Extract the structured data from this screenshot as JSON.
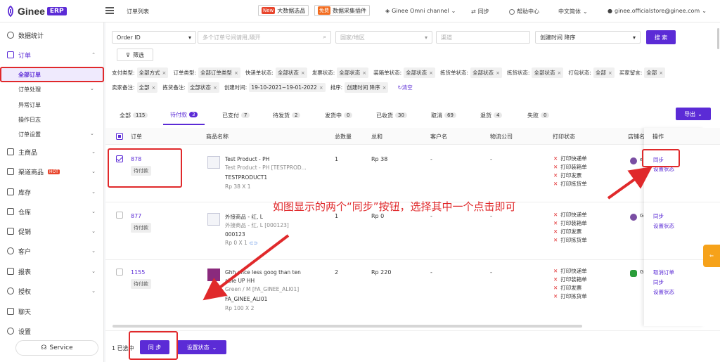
{
  "brand": {
    "name": "Ginee",
    "badge": "ERP"
  },
  "header": {
    "page_title": "订单列表",
    "promo1_tag": "New",
    "promo1_label": "大数据选品",
    "promo2_tag": "免费",
    "promo2_label": "数据采集插件",
    "channel": "Ginee Omni channel",
    "sync": "同步",
    "help": "帮助中心",
    "lang": "中文简体",
    "user": "ginee.officialstore@ginee.com"
  },
  "sidebar": {
    "items": [
      {
        "label": "数据统计"
      },
      {
        "label": "订单"
      },
      {
        "label": "主商品"
      },
      {
        "label": "渠道商品",
        "badge": "HOT"
      },
      {
        "label": "库存"
      },
      {
        "label": "仓库"
      },
      {
        "label": "促销"
      },
      {
        "label": "客户"
      },
      {
        "label": "报表"
      },
      {
        "label": "授权"
      },
      {
        "label": "聊天"
      },
      {
        "label": "设置"
      }
    ],
    "sub": [
      "全部订单",
      "订单处理",
      "异常订单",
      "操作日志",
      "订单设置"
    ],
    "service": "Service"
  },
  "filters": {
    "order_id": "Order ID",
    "order_ids_placeholder": "多个订单号间请用,隔开",
    "country_placeholder": "国家/地区",
    "channel_placeholder": "渠道",
    "sort": "创建时间 降序",
    "search": "搜 索",
    "filter_btn": "筛选",
    "row1": [
      {
        "k": "支付类型:",
        "v": "全部方式"
      },
      {
        "k": "订单类型:",
        "v": "全部订单类型"
      },
      {
        "k": "快递单状态:",
        "v": "全部状态"
      },
      {
        "k": "发票状态:",
        "v": "全部状态"
      },
      {
        "k": "装箱单状态:",
        "v": "全部状态"
      },
      {
        "k": "拣货单状态:",
        "v": "全部状态"
      },
      {
        "k": "拣货状态:",
        "v": "全部状态"
      },
      {
        "k": "打包状态:",
        "v": "全部"
      },
      {
        "k": "买家留言:",
        "v": "全部"
      }
    ],
    "row2": [
      {
        "k": "卖家备注:",
        "v": "全部"
      },
      {
        "k": "拣货备注:",
        "v": "全部状态"
      },
      {
        "k": "创建时间:",
        "v": "19-10-2021~19-01-2022"
      },
      {
        "k": "排序:",
        "v": "创建时间 降序"
      }
    ],
    "clear": "清空"
  },
  "tabs": [
    {
      "label": "全部",
      "count": "115"
    },
    {
      "label": "待付款",
      "count": "3"
    },
    {
      "label": "已支付",
      "count": "7"
    },
    {
      "label": "待发货",
      "count": "2"
    },
    {
      "label": "发货中",
      "count": "0"
    },
    {
      "label": "已收货",
      "count": "30"
    },
    {
      "label": "取消",
      "count": "69"
    },
    {
      "label": "退货",
      "count": "4"
    },
    {
      "label": "失败",
      "count": "0"
    }
  ],
  "export": "导出",
  "table": {
    "headers": [
      "订单",
      "商品名称",
      "总数量",
      "总和",
      "客户名",
      "物流公司",
      "打印状态",
      "店铺名",
      "操作"
    ],
    "rows": [
      {
        "order": "878",
        "status": "待付款",
        "p1": "Test Product - PH",
        "p2": "Test Product - PH [TESTPROD...",
        "p3": "TESTPRODUCT1",
        "p4": "Rp 38 X 1",
        "qty": "1",
        "total": "Rp 38",
        "customer": "-",
        "logistics": "-",
        "ops": [
          "同步",
          "设置状态"
        ],
        "store": "e"
      },
      {
        "order": "877",
        "status": "待付款",
        "p1": "外接商品 - 红, L",
        "p2": "外接商品 - 红, L [000123]",
        "p3": "000123",
        "p4": "Rp 0 X 1",
        "qty": "1",
        "total": "Rp 0",
        "customer": "-",
        "logistics": "-",
        "ops": [
          "同步",
          "设置状态"
        ],
        "store": "G"
      },
      {
        "order": "1155",
        "status": "待付款",
        "p1": "Ghh once less goog than ten",
        "p2": "able UP HH",
        "p3": "Green / M [FA_GINEE_ALI01]",
        "p4": "FA_GINEE_ALI01",
        "p5": "Rp 100 X 2",
        "qty": "2",
        "total": "Rp 220",
        "customer": "-",
        "logistics": "-",
        "ops": [
          "取消订单",
          "同步",
          "设置状态"
        ],
        "store": "G"
      }
    ],
    "print_status": [
      "打印快递单",
      "打印装箱单",
      "打印发票",
      "打印拣货单"
    ]
  },
  "footer": {
    "selected": "1 已选中",
    "sync": "同 步",
    "set_status": "设置状态"
  },
  "annotation": "如图显示的两个“同步”按钮，选择其中一个点击即可",
  "colors": {
    "primary": "#5b2bd6",
    "highlight": "#e0292b"
  }
}
